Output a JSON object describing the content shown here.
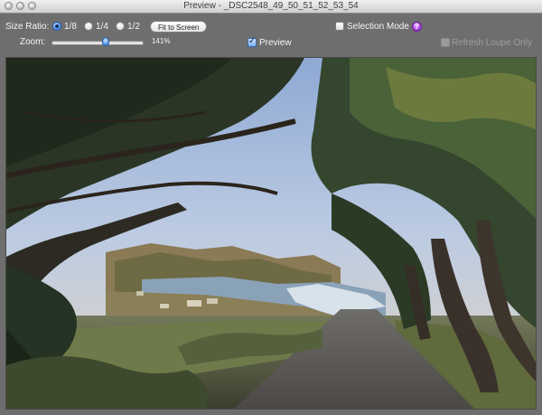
{
  "window": {
    "title": "Preview - _DSC2548_49_50_51_52_53_54"
  },
  "toolbar": {
    "size_ratio_label": "Size Ratio:",
    "ratios": [
      {
        "label": "1/8",
        "selected": true
      },
      {
        "label": "1/4",
        "selected": false
      },
      {
        "label": "1/2",
        "selected": false
      }
    ],
    "fit_button": "Fit to Screen",
    "selection_mode_label": "Selection Mode",
    "selection_mode_checked": false,
    "help_glyph": "?",
    "zoom_label": "Zoom:",
    "zoom_value_text": "141%",
    "zoom_fraction": 0.6,
    "preview_label": "Preview",
    "preview_checked": true,
    "refresh_loupe_label": "Refresh Loupe Only",
    "refresh_loupe_enabled": false
  },
  "colors": {
    "accent": "#3e8ae8",
    "toolbar_bg": "#6e6e6e",
    "help_icon": "#a536d9"
  }
}
